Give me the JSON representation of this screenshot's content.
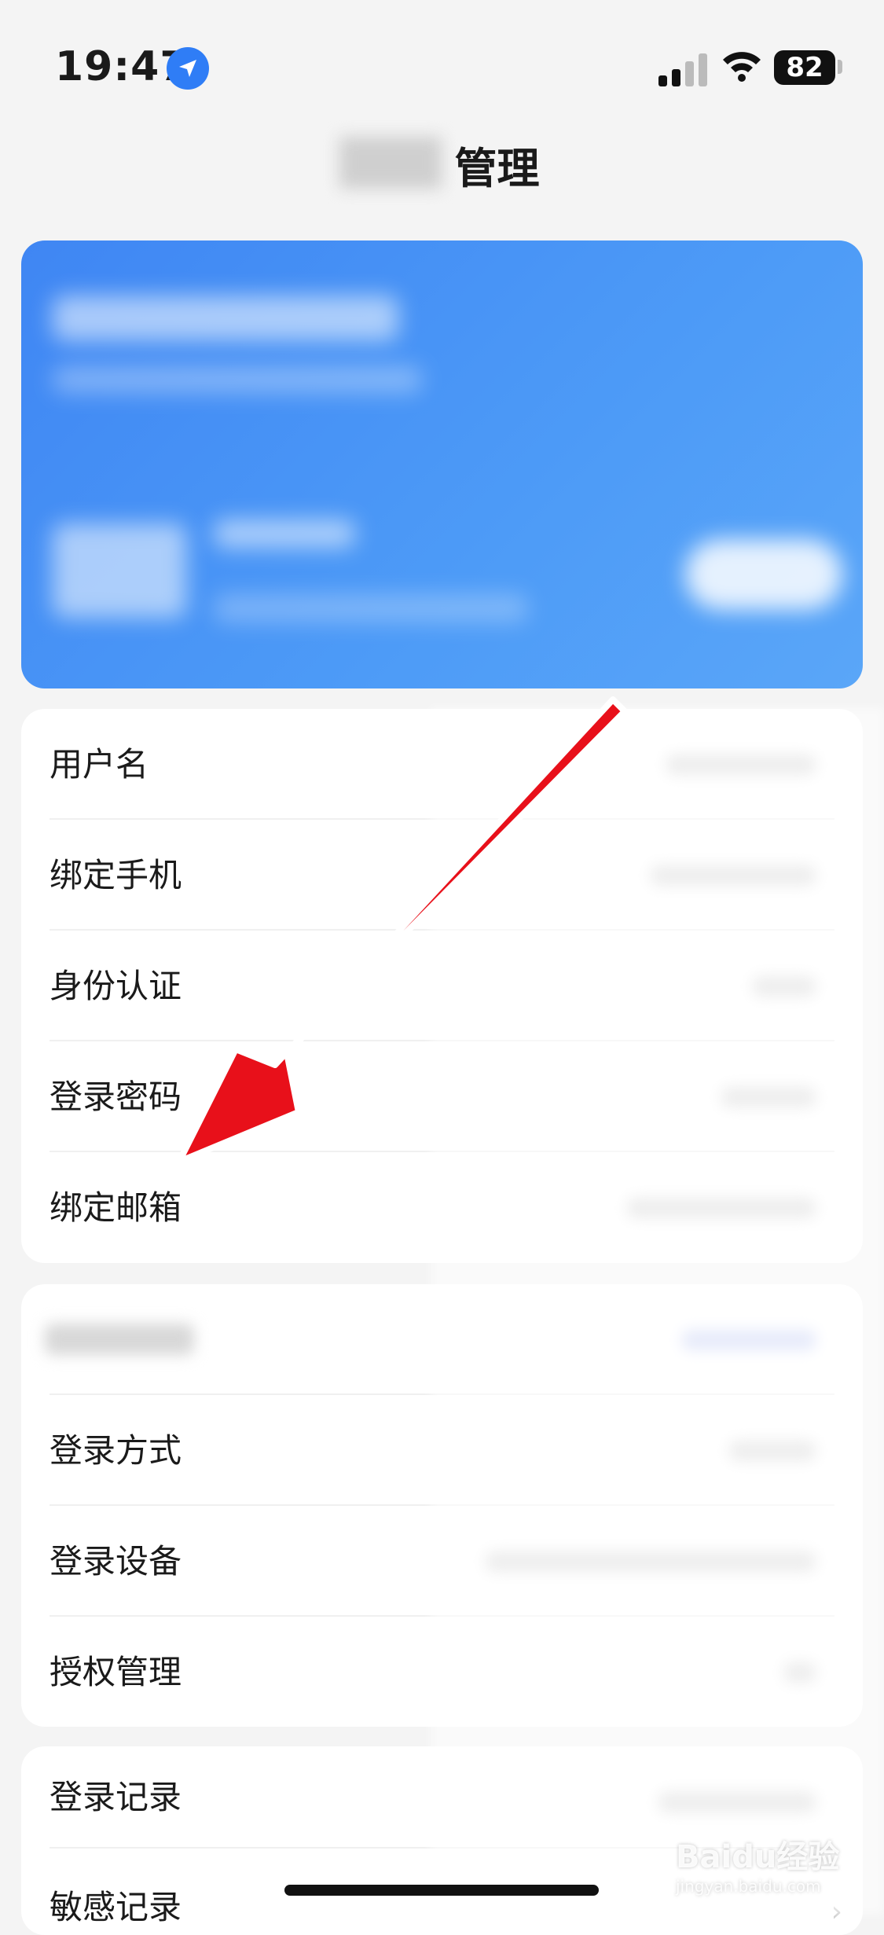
{
  "status_bar": {
    "time": "19:47",
    "battery": "82"
  },
  "header": {
    "title_suffix": "管理"
  },
  "account_section": {
    "rows": [
      {
        "label": "用户名"
      },
      {
        "label": "绑定手机"
      },
      {
        "label": "身份认证"
      },
      {
        "label": "登录密码"
      },
      {
        "label": "绑定邮箱"
      }
    ]
  },
  "security_section": {
    "rows": [
      {
        "label": "登录方式"
      },
      {
        "label": "登录设备"
      },
      {
        "label": "授权管理"
      }
    ]
  },
  "records_section": {
    "rows": [
      {
        "label": "登录记录"
      },
      {
        "label": "敏感记录"
      }
    ]
  },
  "watermark": {
    "brand": "Baidu经验",
    "url": "jingyan.baidu.com"
  },
  "colors": {
    "card_blue": "#4a90f5",
    "arrow_red": "#e8101a"
  }
}
